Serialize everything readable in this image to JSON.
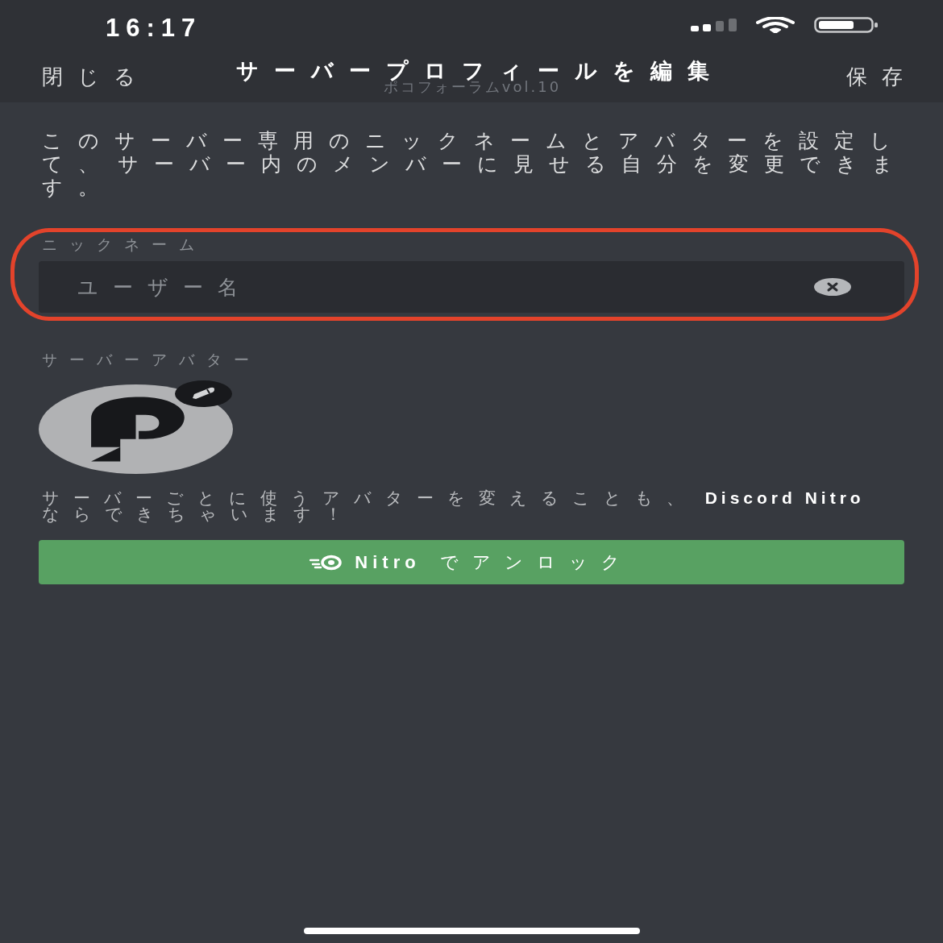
{
  "status_bar": {
    "time": "16:17"
  },
  "nav": {
    "close": "閉じる",
    "title": "サーバープロフィールを編集",
    "subtitle": "ポコフォーラムvol.10",
    "save": "保存"
  },
  "description": "このサーバー専用のニックネームとアバターを設定して、 サーバー内のメンバーに見せる自分を変更できます。",
  "nickname": {
    "label": "ニックネーム",
    "placeholder": "ユーザー名",
    "highlighted": true
  },
  "avatar": {
    "label": "サーバーアバター"
  },
  "nitro_note": "サーバーごとに使うアバターを変えることも、 **Discord Nitro** ならできちゃいます！",
  "unlock_button": "**Nitro** でアンロック"
}
